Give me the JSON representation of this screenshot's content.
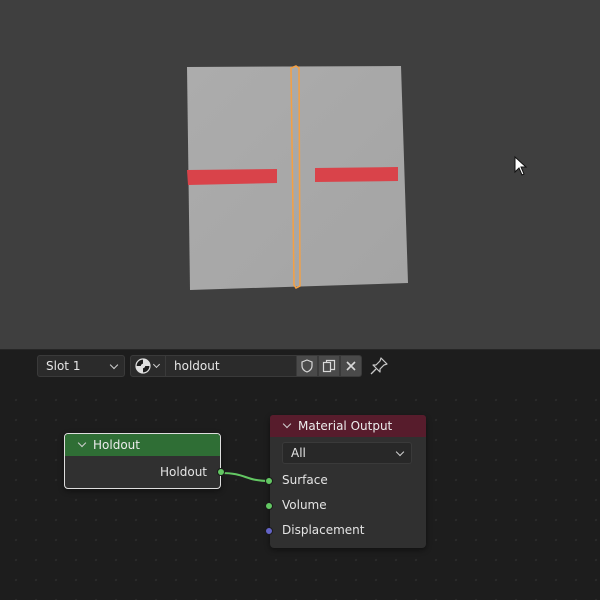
{
  "header": {
    "slot_label": "Slot 1",
    "material_name": "holdout",
    "icons": {
      "browse_material": "material-sphere-icon",
      "fake_user": "shield-icon",
      "duplicate": "duplicate-icon",
      "unlink": "close-icon",
      "pin": "pin-icon"
    }
  },
  "nodes": {
    "holdout": {
      "title": "Holdout",
      "output_label": "Holdout",
      "header_color": "#2f6e35"
    },
    "material_output": {
      "title": "Material Output",
      "target": "All",
      "inputs": [
        "Surface",
        "Volume",
        "Displacement"
      ],
      "header_color": "#571c2c"
    }
  },
  "colors": {
    "shader_socket": "#63c763",
    "vector_socket": "#6363c7",
    "selection_outline": "#f5a043",
    "plane_marks": "#d9434a"
  }
}
